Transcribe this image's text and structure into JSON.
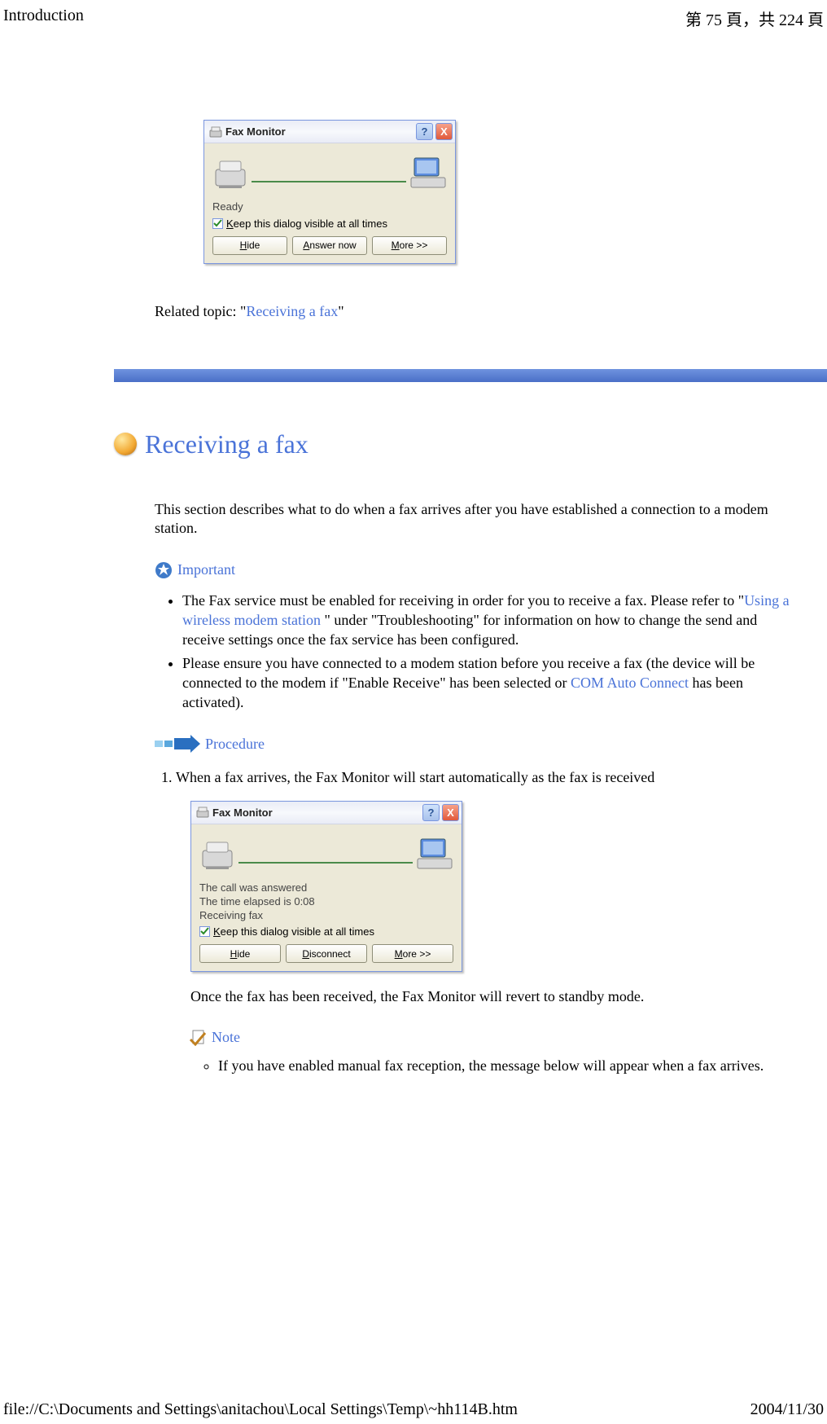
{
  "header": {
    "left": "Introduction",
    "right": "第 75 頁，共 224 頁"
  },
  "dialog1": {
    "title": "Fax Monitor",
    "help": "?",
    "close": "X",
    "status": "Ready",
    "checkbox": "Keep this dialog visible at all times",
    "btn_hide": "Hide",
    "btn_answer": "Answer now",
    "btn_more": "More >>"
  },
  "related": {
    "prefix": "Related topic: \"",
    "link": "Receiving a fax",
    "suffix": "\""
  },
  "section": {
    "title": "Receiving a fax",
    "intro": "This section describes what to do when a fax arrives after you have established a connection to a modem station.",
    "important_label": "Important",
    "bullet1_a": "The Fax service must be enabled for receiving in order for you to receive a fax. Please refer to \"",
    "bullet1_link": "Using a wireless modem station",
    "bullet1_b": " \" under \"Troubleshooting\" for information on how to change the send and receive settings once the fax service has been configured.",
    "bullet2_a": "Please ensure you have connected to a modem station before you receive a fax (the device will be connected to the modem if \"Enable Receive\" has been selected or  ",
    "bullet2_link": "COM Auto Connect",
    "bullet2_b": " has been activated).",
    "procedure_label": "Procedure",
    "step1": "When a fax arrives, the Fax Monitor will start automatically as the fax is received",
    "after": "Once the fax has been received, the Fax Monitor will revert to standby mode.",
    "note_label": "Note",
    "note1": "If you have enabled manual fax reception, the message below will appear when a fax arrives."
  },
  "dialog2": {
    "title": "Fax Monitor",
    "help": "?",
    "close": "X",
    "line1": "The call was answered",
    "line2": "The time elapsed is 0:08",
    "line3": "Receiving fax",
    "checkbox": "Keep this dialog visible at all times",
    "btn_hide": "Hide",
    "btn_disc": "Disconnect",
    "btn_more": "More >>"
  },
  "footer": {
    "left": "file://C:\\Documents and Settings\\anitachou\\Local Settings\\Temp\\~hh114B.htm",
    "right": "2004/11/30"
  }
}
